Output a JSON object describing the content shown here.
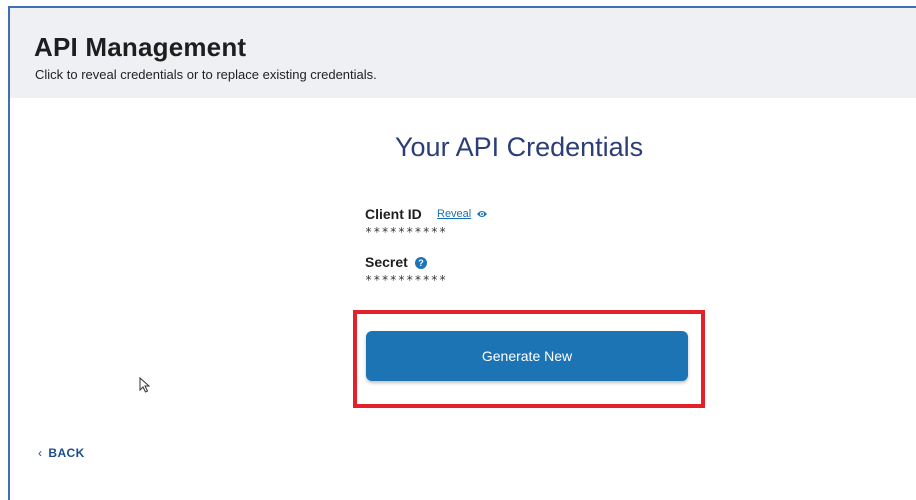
{
  "header": {
    "title": "API Management",
    "subtitle": "Click to reveal credentials or to replace existing credentials."
  },
  "credentials": {
    "title": "Your API Credentials",
    "client_id": {
      "label": "Client ID",
      "reveal_label": "Reveal",
      "value": "**********"
    },
    "secret": {
      "label": "Secret",
      "value": "**********"
    }
  },
  "actions": {
    "generate_label": "Generate New",
    "back_chevron": "‹",
    "back_label": "BACK"
  },
  "colors": {
    "accent": "#1c74b4",
    "highlight": "#e3212a",
    "title": "#2c3e78"
  },
  "icons": {
    "reveal": "eye-icon",
    "secret_help": "help-icon",
    "pointer": "cursor-icon"
  }
}
